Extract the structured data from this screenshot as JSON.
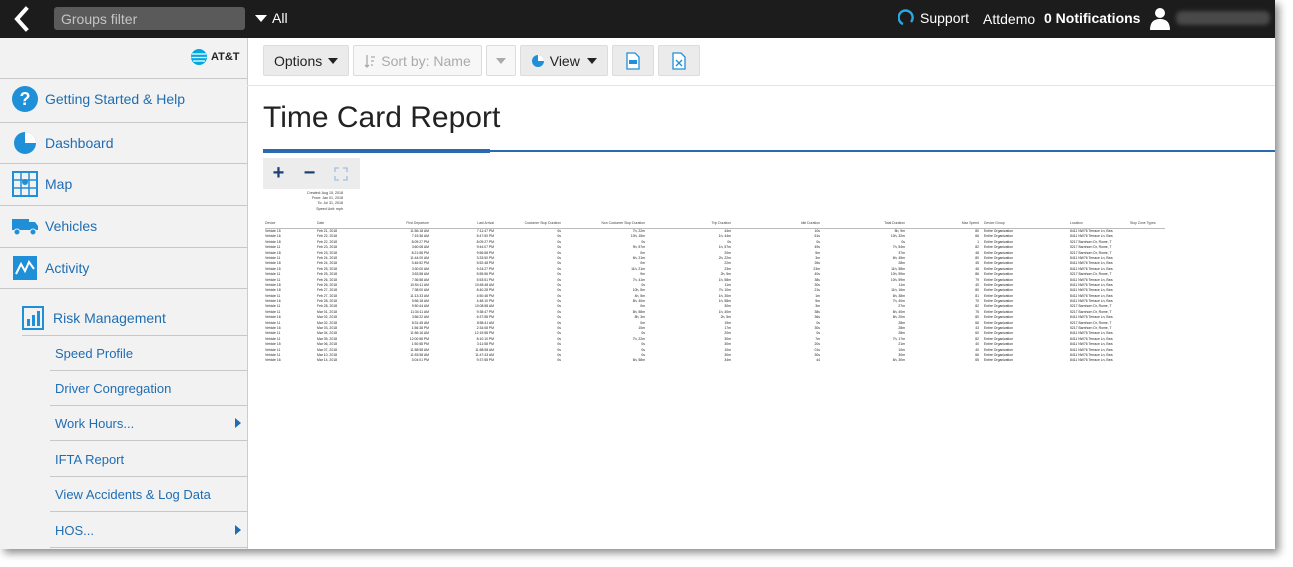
{
  "topbar": {
    "groups_filter_placeholder": "Groups filter",
    "all_label": "All",
    "support_label": "Support",
    "user_label": "Attdemo",
    "notifications_label": "0 Notifications"
  },
  "sidebar": {
    "brand": "AT&T",
    "items": [
      {
        "label": "Getting Started & Help",
        "icon": "help-icon"
      },
      {
        "label": "Dashboard",
        "icon": "dashboard-icon"
      },
      {
        "label": "Map",
        "icon": "map-icon"
      },
      {
        "label": "Vehicles",
        "icon": "truck-icon"
      },
      {
        "label": "Activity",
        "icon": "activity-icon"
      }
    ],
    "risk_management": "Risk Management",
    "sub_items": [
      {
        "label": "Speed Profile",
        "has_children": false
      },
      {
        "label": "Driver Congregation",
        "has_children": false
      },
      {
        "label": "Work Hours...",
        "has_children": true
      },
      {
        "label": "IFTA Report",
        "has_children": false
      },
      {
        "label": "View Accidents & Log Data",
        "has_children": false
      },
      {
        "label": "HOS...",
        "has_children": true
      }
    ]
  },
  "toolbar": {
    "options_label": "Options",
    "sort_label": "Sort by: Name",
    "view_label": "View"
  },
  "page": {
    "title": "Time Card Report"
  },
  "zoom": {
    "plus": "+",
    "minus": "−"
  },
  "report_meta": {
    "lines": [
      "Created: Aug 15, 2018",
      "From: Jan 01, 2018",
      "To: Jul 31, 2018",
      "Speed Unit: mph"
    ]
  },
  "report": {
    "headers": [
      "Device",
      "Date",
      "First Departure",
      "Last Arrival",
      "Customer Stop Duration",
      "Non Customer Stop Duration",
      "Trip Duration",
      "Idle Duration",
      "Total Duration",
      "Max Speed",
      "Device Group",
      "Location",
      "Stop Zone Types"
    ],
    "rows": [
      [
        "Vehicle 15",
        "Feb 21, 2018",
        "11:56:18 AM",
        "7:11:47 PM",
        "0s",
        "7h, 22m",
        "44m",
        "10s",
        "8h, 9m",
        "80",
        "Entire Organization",
        "8411 NW76 Terrace Ln, Bea",
        ""
      ],
      [
        "Vehicle 16",
        "Feb 22, 2018",
        "7:15:36 AM",
        "5:47:50 PM",
        "0s",
        "10h, 15m",
        "1h, 44m",
        "61s",
        "10h, 32m",
        "66",
        "Entire Organization",
        "8411 NW76 Terrace Ln, Bea",
        ""
      ],
      [
        "Vehicle 18",
        "Feb 22, 2018",
        "8:09:27 PM",
        "8:09:27 PM",
        "0s",
        "0s",
        "0s",
        "0s",
        "0s",
        "1",
        "Entire Organization",
        "5217 Barnhorn Dr, Rome, T",
        ""
      ],
      [
        "Vehicle 11",
        "Feb 23, 2018",
        "3:60:08 AM",
        "9:44:07 PM",
        "0s",
        "9h, 57m",
        "1h, 57m",
        "49s",
        "7h, 54m",
        "82",
        "Entire Organization",
        "5217 Barnhorn Dr, Rome, T",
        ""
      ],
      [
        "Vehicle 18",
        "Feb 23, 2018",
        "8:21:58 PM",
        "9:56:58 PM",
        "0s",
        "0m",
        "20m",
        "5m",
        "37m",
        "48",
        "Entire Organization",
        "5217 Barnhorn Dr, Rome, T",
        ""
      ],
      [
        "Vehicle 11",
        "Feb 24, 2018",
        "11:44:00 AM",
        "3:33:50 PM",
        "0s",
        "6h, 21m",
        "2h, 22m",
        "3m",
        "6h, 45m",
        "80",
        "Entire Organization",
        "8411 NW76 Terrace Ln, Bea",
        ""
      ],
      [
        "Vehicle 18",
        "Feb 24, 2018",
        "3:46:52 PM",
        "5:52:48 PM",
        "0s",
        "0m",
        "22m",
        "26s",
        "28m",
        "45",
        "Entire Organization",
        "8411 NW76 Terrace Ln, Bea",
        ""
      ],
      [
        "Vehicle 15",
        "Feb 25, 2018",
        "3:30:00 AM",
        "9:24:27 PM",
        "0s",
        "11h, 21m",
        "23m",
        "23m",
        "11h, 58m",
        "46",
        "Entire Organization",
        "8411 NW76 Terrace Ln, Bea",
        ""
      ],
      [
        "Vehicle 11",
        "Feb 25, 2018",
        "3:53:58 AM",
        "5:55:56 PM",
        "0s",
        "9m",
        "2h, 5m",
        "40s",
        "10h, 59m",
        "86",
        "Entire Organization",
        "5217 Barnhorn Dr, Rome, T",
        ""
      ],
      [
        "Vehicle 11",
        "Feb 26, 2018",
        "7:36:58 AM",
        "5:53:51 PM",
        "0s",
        "7h, 41m",
        "1h, 58m",
        "38s",
        "10h, 59m",
        "79",
        "Entire Organization",
        "8411 NW76 Terrace Ln, Bea",
        ""
      ],
      [
        "Vehicle 18",
        "Feb 26, 2018",
        "10:54:11 AM",
        "10:48:48 AM",
        "0s",
        "0s",
        "11m",
        "30s",
        "11m",
        "40",
        "Entire Organization",
        "8411 NW76 Terrace Ln, Bea",
        ""
      ],
      [
        "Vehicle 18",
        "Feb 27, 2018",
        "7:38:00 AM",
        "8:40:28 PM",
        "0s",
        "10h, 5m",
        "7h, 10m",
        "21s",
        "11h, 16m",
        "80",
        "Entire Organization",
        "8411 NW76 Terrace Ln, Bea",
        ""
      ],
      [
        "Vehicle 11",
        "Feb 27, 2018",
        "11:13:33 AM",
        "4:50:48 PM",
        "0s",
        "4h, 5m",
        "1h, 30m",
        "1m",
        "6h, 38m",
        "81",
        "Entire Organization",
        "8411 NW76 Terrace Ln, Bea",
        ""
      ],
      [
        "Vehicle 16",
        "Feb 28, 2018",
        "5:56:18 AM",
        "4:48:10 PM",
        "0s",
        "8h, 40m",
        "1h, 58m",
        "5m",
        "7h, 40m",
        "70",
        "Entire Organization",
        "8411 NW76 Terrace Ln, Bea",
        ""
      ],
      [
        "Vehicle 11",
        "Feb 28, 2018",
        "9:50:44 AM",
        "10:08:58 AM",
        "0s",
        "0m",
        "30m",
        "3m",
        "27m",
        "82",
        "Entire Organization",
        "5217 Barnhorn Dr, Rome, T",
        ""
      ],
      [
        "Vehicle 11",
        "Mar 01, 2018",
        "11:34:11 AM",
        "9:38:47 PM",
        "0s",
        "8h, 58m",
        "1h, 40m",
        "38s",
        "8h, 40m",
        "75",
        "Entire Organization",
        "5217 Barnhorn Dr, Rome, T",
        ""
      ],
      [
        "Vehicle 16",
        "Mar 02, 2018",
        "3:56:22 AM",
        "6:37:58 PM",
        "0s",
        "8h, 3m",
        "2h, 5m",
        "36s",
        "8h, 20m",
        "80",
        "Entire Organization",
        "8411 NW76 Terrace Ln, Bea",
        ""
      ],
      [
        "Vehicle 11",
        "Mar 02, 2018",
        "8:31:45 AM",
        "8:58:41 AM",
        "0s",
        "0m",
        "19m",
        "0s",
        "28m",
        "66",
        "Entire Organization",
        "5217 Barnhorn Dr, Rome, T",
        ""
      ],
      [
        "Vehicle 16",
        "Mar 03, 2018",
        "1:56:38 PM",
        "2:34:08 PM",
        "0s",
        "10m",
        "17m",
        "30s",
        "28m",
        "43",
        "Entire Organization",
        "5217 Barnhorn Dr, Rome, T",
        ""
      ],
      [
        "Vehicle 11",
        "Mar 04, 2018",
        "11:56:16 AM",
        "12:19:58 PM",
        "0s",
        "0s",
        "20m",
        "0s",
        "28m",
        "60",
        "Entire Organization",
        "8411 NW76 Terrace Ln, Bea",
        ""
      ],
      [
        "Vehicle 11",
        "Mar 05, 2018",
        "12:00:58 PM",
        "8:10:10 PM",
        "0s",
        "7h, 22m",
        "30m",
        "7m",
        "7h, 17m",
        "82",
        "Entire Organization",
        "8411 NW76 Terrace Ln, Bea",
        ""
      ],
      [
        "Vehicle 15",
        "Mar 06, 2018",
        "1:50:58 PM",
        "3:11:58 PM",
        "0s",
        "0s",
        "30m",
        "20s",
        "21m",
        "40",
        "Entire Organization",
        "8411 NW76 Terrace Ln, Bea",
        ""
      ],
      [
        "Vehicle 11",
        "Mar 07, 2018",
        "11:58:58 AM",
        "11:58:58 AM",
        "0s",
        "0s",
        "10m",
        "01s",
        "10m",
        "40",
        "Entire Organization",
        "8411 NW76 Terrace Ln, Bea",
        ""
      ],
      [
        "Vehicle 11",
        "Mar 10, 2018",
        "11:53:58 AM",
        "11:47:43 AM",
        "0s",
        "0s",
        "30m",
        "30s",
        "30m",
        "66",
        "Entire Organization",
        "8411 NW76 Terrace Ln, Bea",
        ""
      ],
      [
        "Vehicle 16",
        "Mar 14, 2018",
        "3:04:01 PM",
        "9:37:58 PM",
        "0s",
        "6h, 58m",
        "34m",
        "44",
        "6h, 30m",
        "65",
        "Entire Organization",
        "8411 NW76 Terrace Ln, Bea",
        ""
      ]
    ]
  },
  "colors": {
    "topbar": "#1c1c1c",
    "accent": "#1f6db3",
    "title_line": "#2a6bb0",
    "sidebar_bg": "#f2f2f2"
  }
}
